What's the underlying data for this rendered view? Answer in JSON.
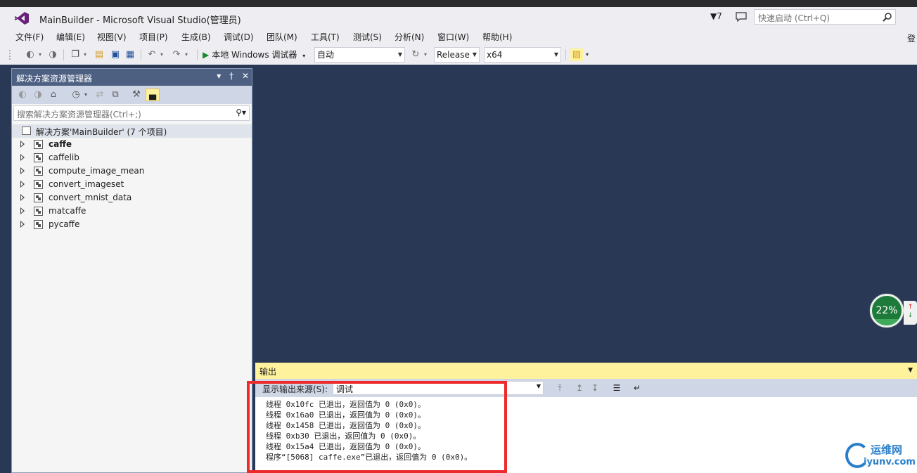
{
  "window": {
    "title": "MainBuilder - Microsoft Visual Studio(管理员)",
    "notification_count": "7",
    "quick_launch_placeholder": "快速启动 (Ctrl+Q)"
  },
  "menu": {
    "items": [
      "文件(F)",
      "编辑(E)",
      "视图(V)",
      "项目(P)",
      "生成(B)",
      "调试(D)",
      "团队(M)",
      "工具(T)",
      "测试(S)",
      "分析(N)",
      "窗口(W)",
      "帮助(H)"
    ],
    "signin": "登"
  },
  "toolbar": {
    "run_label": "本地 Windows 调试器",
    "config_auto": "自动",
    "configuration": "Release",
    "platform": "x64"
  },
  "solution_explorer": {
    "title": "解决方案资源管理器",
    "search_placeholder": "搜索解决方案资源管理器(Ctrl+;)",
    "root": "解决方案'MainBuilder' (7 个项目)",
    "projects": [
      "caffe",
      "caffelib",
      "compute_image_mean",
      "convert_imageset",
      "convert_mnist_data",
      "matcaffe",
      "pycaffe"
    ],
    "startup_project": "caffe"
  },
  "output": {
    "title": "输出",
    "source_label": "显示输出来源(S):",
    "source_value": "调试",
    "lines": [
      "线程 0x10fc 已退出，返回值为 0 (0x0)。",
      "线程 0x16a0 已退出，返回值为 0 (0x0)。",
      "线程 0x1458 已退出，返回值为 0 (0x0)。",
      "线程 0xb30 已退出，返回值为 0 (0x0)。",
      "线程 0x15a4 已退出，返回值为 0 (0x0)。",
      "程序“[5068] caffe.exe”已退出，返回值为 0 (0x0)。"
    ]
  },
  "widget": {
    "percent_text": "22%",
    "percent_value": 22
  },
  "watermark": {
    "cn": "运维网",
    "en": "iyunv.com"
  },
  "colors": {
    "editor_bg": "#293955",
    "panel_title": "#4d6082",
    "output_title": "#fff29d",
    "highlight_box": "#ee2b2b",
    "accent_purple": "#68217a"
  }
}
